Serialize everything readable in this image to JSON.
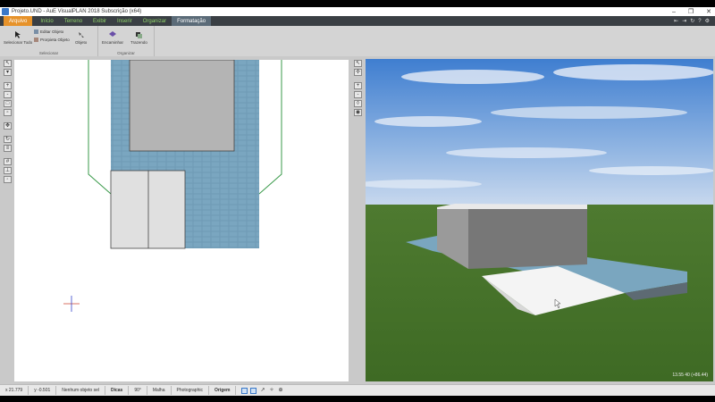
{
  "window": {
    "title": "Projeto.UND - AuE VisualPLAN 2018 Subscrição (x64)",
    "buttons": [
      "–",
      "❐",
      "✕"
    ]
  },
  "tabs": {
    "file": "Arquivo",
    "items": [
      "Início",
      "Terreno",
      "Exibir",
      "Inserir",
      "Organizar"
    ],
    "active": "Formatação"
  },
  "ribbon": {
    "select_all": "Selecionar Todo",
    "edit_object": "Editar Objeto",
    "properties_object": "Prorpieta Objeto",
    "objects": "Objeto",
    "group1_label": "Selecionar",
    "bring_forward": "Encaminhar",
    "send_back": "Trazendo",
    "group2_label": "Organizar"
  },
  "status": {
    "x": "x 21.779",
    "y": "y -0.501",
    "selection": "Nenhum objeto sel",
    "snap": "Dicas",
    "angle": "90°",
    "grid": "Malha",
    "render": "Photographic",
    "origin": "Origem"
  },
  "view3d": {
    "info": "13.55   40   (+86.44)"
  },
  "colors": {
    "accent": "#e6922a",
    "tab_text": "#8fd16a",
    "ribbon_dark": "#3a3f44"
  }
}
